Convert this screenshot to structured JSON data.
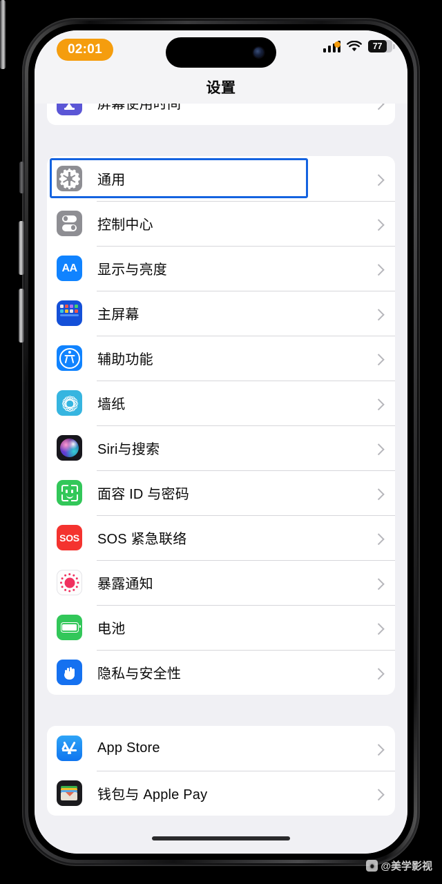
{
  "device": {
    "buttons": [
      "action-button",
      "volume-up",
      "volume-down",
      "power-button"
    ]
  },
  "status_bar": {
    "time": "02:01",
    "battery_percent": "77",
    "battery_level": 77,
    "signal_bars": 4,
    "wifi": "wifi-icon",
    "privacy_indicator": "orange-dot",
    "time_pill_color": "#f59d0e"
  },
  "nav": {
    "title": "设置"
  },
  "selection": {
    "target_row": "通用",
    "border_color": "#1463e0"
  },
  "sections": [
    {
      "id": "screen-time",
      "clipped": true,
      "rows": [
        {
          "label": "屏幕使用时间",
          "icon": "hourglass-icon",
          "icon_color": "#5b56d6",
          "chevron": true
        }
      ]
    },
    {
      "id": "system",
      "rows": [
        {
          "label": "通用",
          "icon": "gear-icon",
          "icon_color": "#8e8e93",
          "chevron": true,
          "selected": true
        },
        {
          "label": "控制中心",
          "icon": "control-center-icon",
          "icon_color": "#8e8e93",
          "chevron": true
        },
        {
          "label": "显示与亮度",
          "icon": "display-aa-icon",
          "icon_color": "#1083ff",
          "chevron": true
        },
        {
          "label": "主屏幕",
          "icon": "home-screen-icon",
          "icon_color": "#1450d8",
          "chevron": true
        },
        {
          "label": "辅助功能",
          "icon": "accessibility-icon",
          "icon_color": "#1083ff",
          "chevron": true
        },
        {
          "label": "墙纸",
          "icon": "wallpaper-icon",
          "icon_color": "#36b5e0",
          "chevron": true
        },
        {
          "label": "Siri与搜索",
          "icon": "siri-icon",
          "icon_color": "#17161c",
          "chevron": true
        },
        {
          "label": "面容 ID 与密码",
          "icon": "face-id-icon",
          "icon_color": "#32c759",
          "chevron": true
        },
        {
          "label": "SOS 紧急联络",
          "icon": "sos-icon",
          "icon_color": "#f4332f",
          "chevron": true
        },
        {
          "label": "暴露通知",
          "icon": "exposure-notification-icon",
          "icon_color": "#f0315f",
          "chevron": true
        },
        {
          "label": "电池",
          "icon": "battery-icon",
          "icon_color": "#32c759",
          "chevron": true
        },
        {
          "label": "隐私与安全性",
          "icon": "privacy-hand-icon",
          "icon_color": "#1571f0",
          "chevron": true
        }
      ]
    },
    {
      "id": "store",
      "rows": [
        {
          "label": "App Store",
          "icon": "app-store-icon",
          "icon_color": "#1075ef",
          "chevron": true
        },
        {
          "label": "钱包与 Apple Pay",
          "icon": "wallet-icon",
          "icon_color": "#1b1b1e",
          "chevron": true
        }
      ]
    }
  ],
  "home_indicator": "home-indicator",
  "watermark": {
    "text": "@美学影视",
    "logo": "paw-logo"
  }
}
